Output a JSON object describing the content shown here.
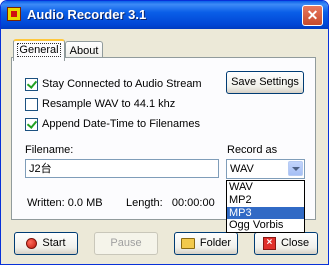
{
  "window": {
    "title": "Audio Recorder 3.1",
    "close_glyph": "✕"
  },
  "tabs": [
    {
      "label": "General",
      "active": true
    },
    {
      "label": "About",
      "active": false
    }
  ],
  "options": {
    "stay_connected": {
      "label": "Stay Connected to Audio Stream",
      "checked": true
    },
    "resample": {
      "label": "Resample WAV to 44.1 khz",
      "checked": false
    },
    "append_datetime": {
      "label": "Append Date-Time to Filenames",
      "checked": true
    }
  },
  "save_settings_label": "Save Settings",
  "filename": {
    "label": "Filename:",
    "value": "J2台"
  },
  "record_as": {
    "label": "Record as",
    "selected": "WAV",
    "options": [
      "WAV",
      "MP2",
      "MP3",
      "Ogg Vorbis"
    ],
    "highlighted": "MP3"
  },
  "status": {
    "written": "Written: 0.0 MB",
    "length": "Length:   00:00:00"
  },
  "buttons": {
    "start": "Start",
    "pause": "Pause",
    "folder": "Folder",
    "close": "Close"
  },
  "icons": {
    "app": "app-icon",
    "start": "record-icon",
    "folder": "folder-icon",
    "close": "close-icon"
  }
}
